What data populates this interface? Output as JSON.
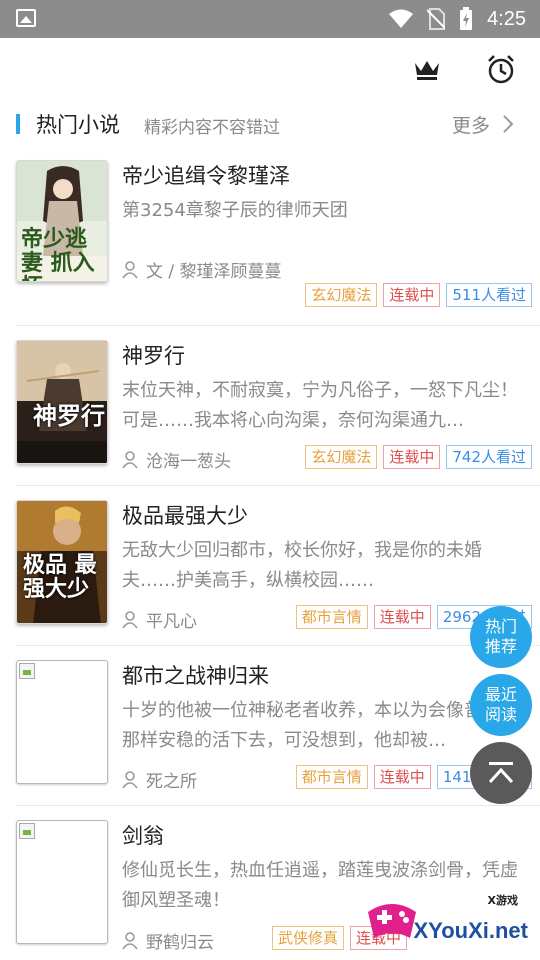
{
  "status_bar": {
    "time": "4:25",
    "icons": [
      "gallery-icon",
      "wifi-icon",
      "no-sim-icon",
      "battery-charging-icon"
    ]
  },
  "toolbar": {
    "icons": [
      "crown-icon",
      "alarm-clock-icon"
    ]
  },
  "section": {
    "title": "热门小说",
    "subtitle": "精彩内容不容错过",
    "more_label": "更多",
    "accent_color": "#2aa7e8"
  },
  "books": [
    {
      "title": "帝少追缉令黎瑾泽",
      "description": "第3254章黎子辰的律师天团",
      "author": "文 / 黎瑾泽顾蔓蔓",
      "category": "玄幻魔法",
      "status": "连载中",
      "views": "511人看过",
      "cover_text": "帝少逃妻 抓入怀"
    },
    {
      "title": "神罗行",
      "description": "末位天神，不耐寂寞，宁为凡俗子，一怒下凡尘！可是……我本将心向沟渠，奈何沟渠通九…",
      "author": "沧海一葱头",
      "category": "玄幻魔法",
      "status": "连载中",
      "views": "742人看过",
      "cover_text": "神罗行"
    },
    {
      "title": "极品最强大少",
      "description": "无敌大少回归都市，校长你好，我是你的未婚夫……护美高手，纵横校园……",
      "author": "平凡心",
      "category": "都市言情",
      "status": "连载中",
      "views": "2962人看过",
      "cover_text": "极品 最强大少"
    },
    {
      "title": "都市之战神归来",
      "description": "十岁的他被一位神秘老者收养，本以为会像普通人那样安稳的活下去，可没想到，他却被…",
      "author": "死之所",
      "category": "都市言情",
      "status": "连载中",
      "views": "1414人看过",
      "cover_text": ""
    },
    {
      "title": "剑翁",
      "description": "修仙觅长生，热血任逍遥，踏莲曳波涤剑骨，凭虚御风塑圣魂！",
      "author": "野鹤归云",
      "category": "武侠修真",
      "status": "连载中",
      "views": "",
      "cover_text": ""
    }
  ],
  "fabs": {
    "hot": "热门\n推荐",
    "recent": "最近\n阅读",
    "top_icon": "back-to-top-icon"
  },
  "watermark": {
    "brand": "XYouXi.net",
    "small": "X游戏"
  }
}
